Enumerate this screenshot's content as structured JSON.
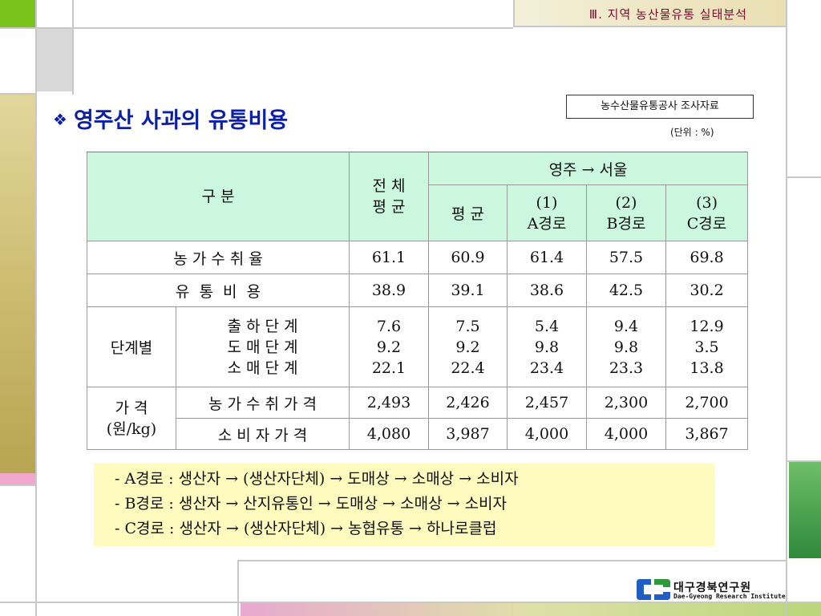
{
  "header": {
    "section_title": "Ⅲ. 지역 농산물유통 실태분석"
  },
  "title": {
    "bullet": "❖",
    "text": "영주산 사과의 유통비용"
  },
  "source_note": "농수산물유통공사 조사자료",
  "unit_note": "(단위 : %)",
  "table": {
    "header_category": "구    분",
    "header_total": "전 체\n평 균",
    "header_route_group": "영주 → 서울",
    "header_avg": "평 균",
    "header_route1": "(1)\nA경로",
    "header_route2": "(2)\nB경로",
    "header_route3": "(3)\nC경로",
    "rows": {
      "farm_share": {
        "label": "농 가 수 취 율",
        "values": [
          "61.1",
          "60.9",
          "61.4",
          "57.5",
          "69.8"
        ]
      },
      "dist_cost": {
        "label": "유  통  비  용",
        "values": [
          "38.9",
          "39.1",
          "38.6",
          "42.5",
          "30.2"
        ]
      },
      "stage": {
        "group_label": "단계별",
        "sub_labels": "출 하 단 계\n도 매 단 계\n소 매 단 계",
        "values": [
          "7.6\n9.2\n22.1",
          "7.5\n9.2\n22.4",
          "5.4\n9.8\n23.4",
          "9.4\n9.8\n23.3",
          "12.9\n3.5\n13.8"
        ]
      },
      "price": {
        "group_label": "가  격\n(원/kg)",
        "farm_label": "농 가 수 취 가 격",
        "farm_values": [
          "2,493",
          "2,426",
          "2,457",
          "2,300",
          "2,700"
        ],
        "consumer_label": "소 비 자 가 격",
        "consumer_values": [
          "4,080",
          "3,987",
          "4,000",
          "4,000",
          "3,867"
        ]
      }
    }
  },
  "notes": [
    "- A경로 : 생산자 → (생산자단체) → 도매상 → 소매상 → 소비자",
    "- B경로 : 생산자 → 산지유통인 → 도매상 → 소매상 → 소비자",
    "- C경로 : 생산자 → (생산자단체) → 농협유통 → 하나로클럽"
  ],
  "logo": {
    "name_ko": "대구경북연구원",
    "name_en": "Dae-Gyeong Research Institute"
  },
  "colors": {
    "title": "#0b1fa8",
    "header_text": "#7a0c2e",
    "table_header_bg": "#ccf7df",
    "notes_bg": "#fffbbf",
    "deco_green": "#7cc21d",
    "deco_gray": "#d8d8d8",
    "deco_pink": "#f1a8cc",
    "deco_olive": "#c9b86a",
    "deco_darkgreen": "#2f8a3a",
    "logo_blue": "#1f5fc4",
    "logo_green": "#2a9a3a"
  }
}
